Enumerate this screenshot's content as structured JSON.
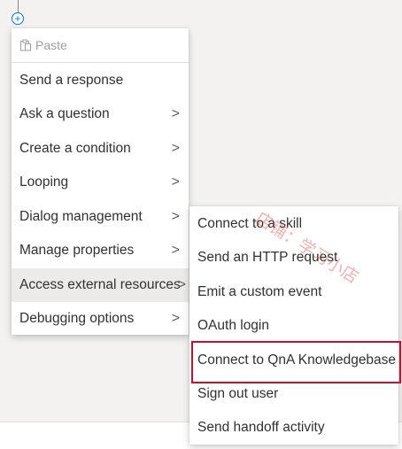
{
  "canvas": {
    "add_node_icon": "add-circle-icon",
    "add_node_glyph": "+"
  },
  "main_menu": {
    "paste": {
      "label": "Paste",
      "icon": "paste-icon",
      "disabled": true
    },
    "items": [
      {
        "label": "Send a response",
        "has_submenu": false
      },
      {
        "label": "Ask a question",
        "has_submenu": true
      },
      {
        "label": "Create a condition",
        "has_submenu": true
      },
      {
        "label": "Looping",
        "has_submenu": true
      },
      {
        "label": "Dialog management",
        "has_submenu": true
      },
      {
        "label": "Manage properties",
        "has_submenu": true
      },
      {
        "label": "Access external resources",
        "has_submenu": true,
        "active": true
      },
      {
        "label": "Debugging options",
        "has_submenu": true
      }
    ],
    "chevron_glyph": ">"
  },
  "submenu": {
    "items": [
      {
        "label": "Connect to a skill"
      },
      {
        "label": "Send an HTTP request"
      },
      {
        "label": "Emit a custom event"
      },
      {
        "label": "OAuth login"
      },
      {
        "label": "Connect to QnA Knowledgebase",
        "highlighted": true
      },
      {
        "label": "Sign out user"
      },
      {
        "label": "Send handoff activity"
      }
    ]
  },
  "watermark": {
    "text": "店铺：学习小店"
  },
  "colors": {
    "accent": "#0078d4",
    "highlight_border": "#c8102e",
    "menu_active_bg": "#edebe9",
    "canvas_bg": "#f3f2f1"
  }
}
